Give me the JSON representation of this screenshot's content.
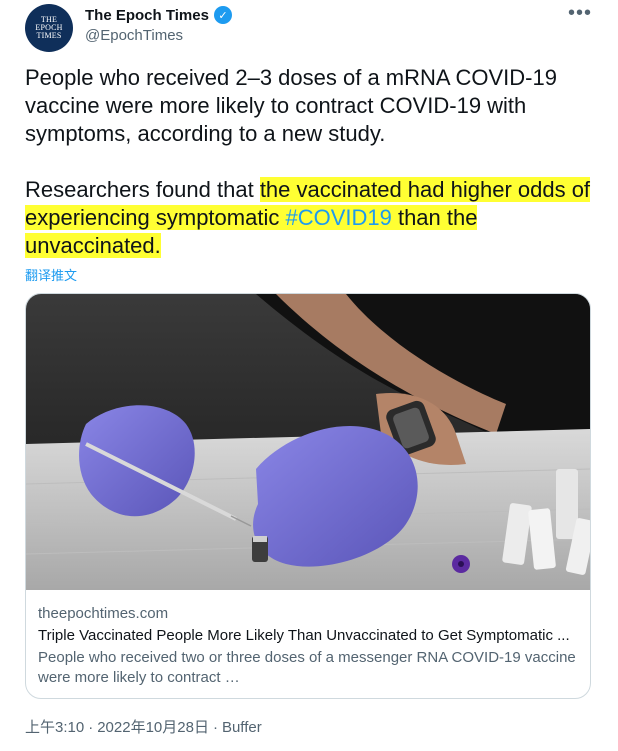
{
  "author": {
    "avatar_lines": [
      "THE",
      "EPOCH",
      "TIMES"
    ],
    "display_name": "The Epoch Times",
    "verified_icon": "✓",
    "handle": "@EpochTimes",
    "more_label": "•••"
  },
  "tweet": {
    "paragraph1": "People who received 2–3 doses of a mRNA COVID-19 vaccine were more likely to contract COVID-19 with symptoms, according to a new study.",
    "para2_plain": "Researchers found that ",
    "para2_hl_a": "the vaccinated had higher odds of experiencing symptomatic ",
    "hashtag": "#COVID19",
    "para2_hl_b": " than the unvaccinated.",
    "translate_label": "翻译推文"
  },
  "card": {
    "domain": "theepochtimes.com",
    "title": "Triple Vaccinated People More Likely Than Unvaccinated to Get Symptomatic ...",
    "description": "People who received two or three doses of a messenger RNA COVID-19 vaccine were more likely to contract …"
  },
  "footer": {
    "time": "上午3:10",
    "separator": "·",
    "date": "2022年10月28日",
    "source": "Buffer"
  },
  "colors": {
    "link_blue": "#1d9bf0",
    "highlight": "#ffff33",
    "muted": "#536471"
  }
}
